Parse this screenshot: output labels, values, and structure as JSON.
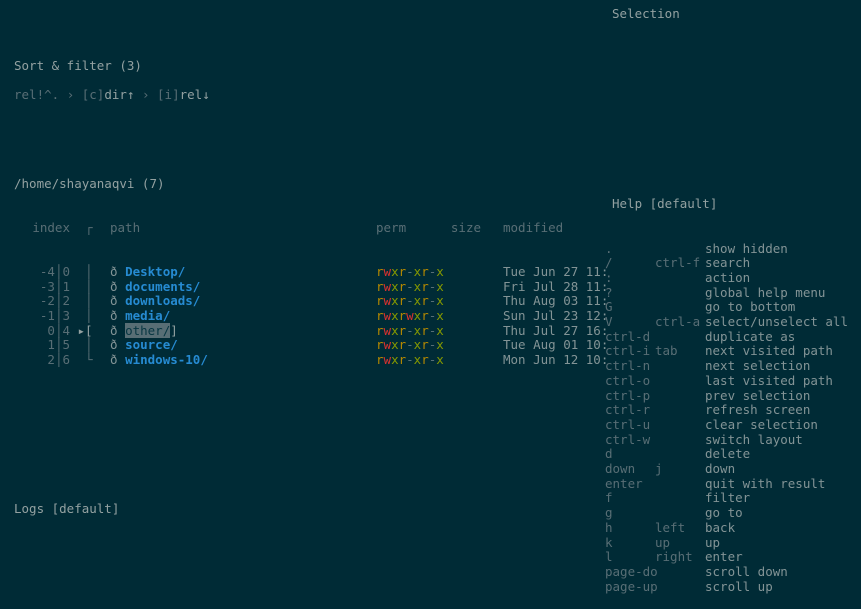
{
  "header": {
    "title": "Sort & filter (3)",
    "breadcrumb_prefix": "rel!^.",
    "sep": "›",
    "crumb1_key": "[c]",
    "crumb1_label": "dir",
    "crumb2_key": "[i]",
    "crumb2_label": "rel"
  },
  "selection_label": "Selection",
  "cwd": "/home/shayanaqvi (7)",
  "columns": {
    "index": "index",
    "path": "path",
    "perm": "perm",
    "size": "size",
    "modified": "modified"
  },
  "rows": [
    {
      "rel": "-4",
      "abs": "0",
      "name": "Desktop/",
      "perm": "rwxr-xr-x",
      "modified": "Tue Jun 27 11:",
      "selected": false
    },
    {
      "rel": "-3",
      "abs": "1",
      "name": "documents/",
      "perm": "rwxr-xr-x",
      "modified": "Fri Jul 28 11:",
      "selected": false
    },
    {
      "rel": "-2",
      "abs": "2",
      "name": "downloads/",
      "perm": "rwxr-xr-x",
      "modified": "Thu Aug 03 11:",
      "selected": false
    },
    {
      "rel": "-1",
      "abs": "3",
      "name": "media/",
      "perm": "rwxrwxr-x",
      "modified": "Sun Jul 23 12:",
      "selected": false
    },
    {
      "rel": "0",
      "abs": "4",
      "name": "other/",
      "perm": "rwxr-xr-x",
      "modified": "Thu Jul 27 16:",
      "selected": true
    },
    {
      "rel": "1",
      "abs": "5",
      "name": "source/",
      "perm": "rwxr-xr-x",
      "modified": "Tue Aug 01 10:",
      "selected": false
    },
    {
      "rel": "2",
      "abs": "6",
      "name": "windows-10/",
      "perm": "rwxr-xr-x",
      "modified": "Mon Jun 12 10:",
      "selected": false
    }
  ],
  "help": {
    "title": "Help [default]",
    "items": [
      {
        "k1": ".",
        "k2": "",
        "desc": "show hidden"
      },
      {
        "k1": "/",
        "k2": "ctrl-f",
        "desc": "search"
      },
      {
        "k1": ":",
        "k2": "",
        "desc": "action"
      },
      {
        "k1": "?",
        "k2": "",
        "desc": "global help menu"
      },
      {
        "k1": "G",
        "k2": "",
        "desc": "go to bottom"
      },
      {
        "k1": "V",
        "k2": "ctrl-a",
        "desc": "select/unselect all"
      },
      {
        "k1": "ctrl-d",
        "k2": "",
        "desc": "duplicate as"
      },
      {
        "k1": "ctrl-i",
        "k2": "tab",
        "desc": "next visited path"
      },
      {
        "k1": "ctrl-n",
        "k2": "",
        "desc": "next selection"
      },
      {
        "k1": "ctrl-o",
        "k2": "",
        "desc": "last visited path"
      },
      {
        "k1": "ctrl-p",
        "k2": "",
        "desc": "prev selection"
      },
      {
        "k1": "ctrl-r",
        "k2": "",
        "desc": "refresh screen"
      },
      {
        "k1": "ctrl-u",
        "k2": "",
        "desc": "clear selection"
      },
      {
        "k1": "ctrl-w",
        "k2": "",
        "desc": "switch layout"
      },
      {
        "k1": "d",
        "k2": "",
        "desc": "delete"
      },
      {
        "k1": "down",
        "k2": "j",
        "desc": "down"
      },
      {
        "k1": "enter",
        "k2": "",
        "desc": "quit with result"
      },
      {
        "k1": "f",
        "k2": "",
        "desc": "filter"
      },
      {
        "k1": "g",
        "k2": "",
        "desc": "go to"
      },
      {
        "k1": "h",
        "k2": "left",
        "desc": "back"
      },
      {
        "k1": "k",
        "k2": "up",
        "desc": "up"
      },
      {
        "k1": "l",
        "k2": "right",
        "desc": "enter"
      },
      {
        "k1": "page-do",
        "k2": "",
        "desc": "scroll down"
      },
      {
        "k1": "page-up",
        "k2": "",
        "desc": "scroll up"
      }
    ]
  },
  "logs_label": "Logs [default]"
}
